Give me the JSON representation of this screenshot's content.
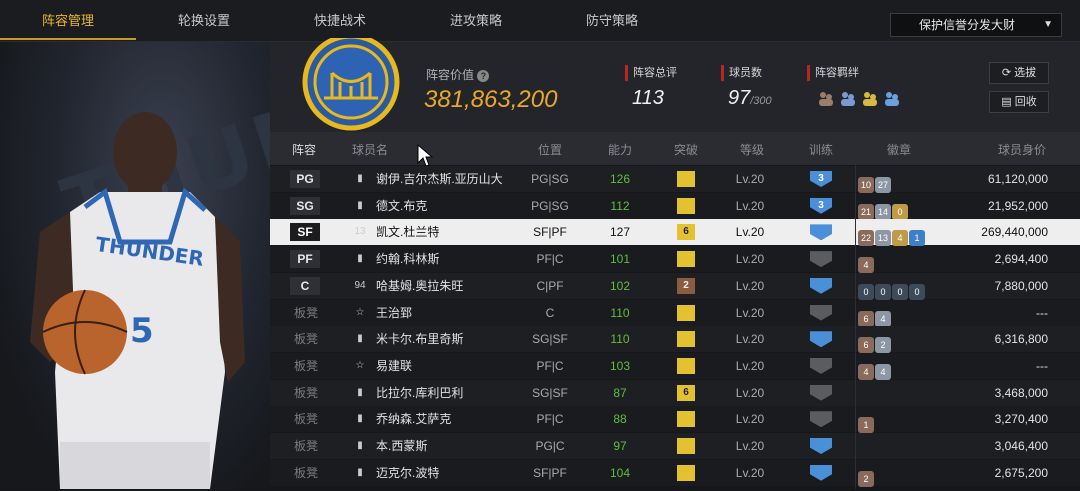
{
  "tabs": [
    "阵容管理",
    "轮换设置",
    "快捷战术",
    "进攻策略",
    "防守策略"
  ],
  "dropdown_value": "保护信誉分发大财",
  "header": {
    "value_label": "阵容价值",
    "value": "381,863,200",
    "rating_label": "阵容总评",
    "rating": "113",
    "players_label": "球员数",
    "players": "97",
    "players_max": "/300",
    "bond_label": "阵容羁绊",
    "btn_select": "选拔",
    "btn_recycle": "回收"
  },
  "background_text": "THUNDER",
  "columns": [
    "阵容",
    "球员名",
    "位置",
    "能力",
    "突破",
    "等级",
    "训练",
    "徽章",
    "球员身价"
  ],
  "rows": [
    {
      "slot": "PG",
      "name": "谢伊.吉尔杰斯.亚历山大",
      "pos": "PG|SG",
      "ability": "126",
      "breakthrough": "",
      "level": "Lv.20",
      "training": "3",
      "badges": [
        "10",
        "27"
      ],
      "worth": "61,120,000"
    },
    {
      "slot": "SG",
      "name": "德文.布克",
      "pos": "PG|SG",
      "ability": "112",
      "breakthrough": "",
      "level": "Lv.20",
      "training": "3",
      "badges": [
        "21",
        "14",
        "0"
      ],
      "worth": "21,952,000"
    },
    {
      "slot": "SF",
      "name": "凯文.杜兰特",
      "pos": "SF|PF",
      "ability": "127",
      "breakthrough": "6",
      "level": "Lv.20",
      "training": "",
      "badges": [
        "22",
        "13",
        "4",
        "1"
      ],
      "worth": "269,440,000",
      "num": "13"
    },
    {
      "slot": "PF",
      "name": "约翰.科林斯",
      "pos": "PF|C",
      "ability": "101",
      "breakthrough": "",
      "level": "Lv.20",
      "training": "",
      "badges": [
        "4"
      ],
      "worth": "2,694,400"
    },
    {
      "slot": "C",
      "name": "哈基姆.奥拉朱旺",
      "pos": "C|PF",
      "ability": "102",
      "breakthrough": "2",
      "level": "Lv.20",
      "training": "",
      "badges": [
        "0",
        "0",
        "0",
        "0"
      ],
      "worth": "7,880,000",
      "num": "94"
    },
    {
      "slot": "板凳",
      "name": "王治郅",
      "pos": "C",
      "ability": "110",
      "breakthrough": "",
      "level": "Lv.20",
      "training": "",
      "badges": [
        "6",
        "4"
      ],
      "worth": "---"
    },
    {
      "slot": "板凳",
      "name": "米卡尔.布里奇斯",
      "pos": "SG|SF",
      "ability": "110",
      "breakthrough": "",
      "level": "Lv.20",
      "training": "",
      "badges": [
        "6",
        "2"
      ],
      "worth": "6,316,800"
    },
    {
      "slot": "板凳",
      "name": "易建联",
      "pos": "PF|C",
      "ability": "103",
      "breakthrough": "",
      "level": "Lv.20",
      "training": "",
      "badges": [
        "4",
        "4"
      ],
      "worth": "---"
    },
    {
      "slot": "板凳",
      "name": "比拉尔.库利巴利",
      "pos": "SG|SF",
      "ability": "87",
      "breakthrough": "6",
      "level": "Lv.20",
      "training": "",
      "badges": [],
      "worth": "3,468,000"
    },
    {
      "slot": "板凳",
      "name": "乔纳森.艾萨克",
      "pos": "PF|C",
      "ability": "88",
      "breakthrough": "",
      "level": "Lv.20",
      "training": "",
      "badges": [
        "1"
      ],
      "worth": "3,270,400"
    },
    {
      "slot": "板凳",
      "name": "本.西蒙斯",
      "pos": "PG|C",
      "ability": "97",
      "breakthrough": "",
      "level": "Lv.20",
      "training": "",
      "badges": [],
      "worth": "3,046,400"
    },
    {
      "slot": "板凳",
      "name": "迈克尔.波特",
      "pos": "SF|PF",
      "ability": "104",
      "breakthrough": "",
      "level": "Lv.20",
      "training": "",
      "badges": [
        "2"
      ],
      "worth": "2,675,200"
    }
  ]
}
